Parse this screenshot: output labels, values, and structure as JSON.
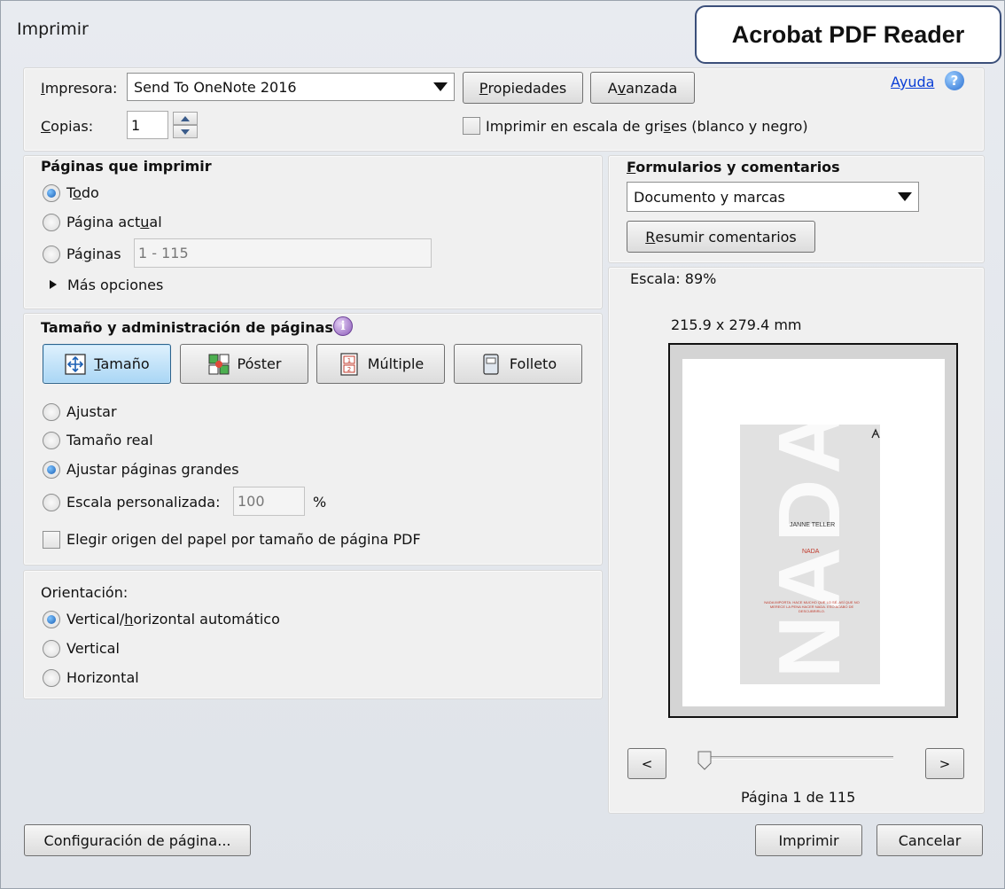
{
  "window": {
    "title": "Imprimir",
    "badge": "Acrobat PDF Reader"
  },
  "printer": {
    "label_pre": "",
    "label_u": "I",
    "label_post": "mpresora:",
    "value": "Send To OneNote 2016",
    "properties_pre": "",
    "properties_u": "P",
    "properties_post": "ropiedades",
    "advanced_pre": "A",
    "advanced_u": "v",
    "advanced_post": "anzada",
    "help_link": "Ayuda",
    "help_icon": "?"
  },
  "copies": {
    "label_pre": "",
    "label_u": "C",
    "label_post": "opias:",
    "value": "1",
    "grayscale_pre": "Imprimir en escala de gri",
    "grayscale_u": "s",
    "grayscale_post": "es (blanco y negro)",
    "grayscale_checked": false
  },
  "pages": {
    "heading": "Páginas que imprimir",
    "all_pre": "T",
    "all_u": "o",
    "all_post": "do",
    "current_pre": "Página act",
    "current_u": "u",
    "current_post": "al",
    "range_pre": "Pá",
    "range_u": "g",
    "range_post": "inas",
    "range_value": "1 - 115",
    "more": "Más opciones",
    "selected": "all"
  },
  "sizing": {
    "heading": "Tamaño y administración de páginas",
    "info_icon": "i",
    "buttons": [
      {
        "pre": "",
        "u": "T",
        "post": "amaño",
        "icon": "size-icon",
        "active": true
      },
      {
        "pre": "Póster",
        "u": "",
        "post": "",
        "icon": "poster-icon",
        "active": false
      },
      {
        "pre": "Múltiple",
        "u": "",
        "post": "",
        "icon": "multiple-icon",
        "active": false
      },
      {
        "pre": "Folleto",
        "u": "",
        "post": "",
        "icon": "booklet-icon",
        "active": false
      }
    ],
    "fit": "Ajustar",
    "actual": "Tamaño real",
    "shrink": "Ajustar páginas grandes",
    "custom": "Escala personalizada:",
    "custom_value": "100",
    "percent": "%",
    "paper_source": "Elegir origen del papel por tamaño de página PDF",
    "selected": "shrink"
  },
  "orientation": {
    "heading": "Orientación:",
    "auto_pre": "Vertical/",
    "auto_u": "h",
    "auto_post": "orizontal automático",
    "portrait": "Vertical",
    "landscape": "Horizontal",
    "selected": "auto"
  },
  "forms": {
    "heading_pre": "",
    "heading_u": "F",
    "heading_post": "ormularios y comentarios",
    "value": "Documento y marcas",
    "summarize_pre": "",
    "summarize_u": "R",
    "summarize_post": "esumir comentarios"
  },
  "preview": {
    "scale": "Escala:  89%",
    "dimensions": "215.9 x 279.4 mm",
    "book": {
      "title": "NADA",
      "author": "JANNE TELLER",
      "subtitle": "NADA",
      "tagline": "NADA IMPORTA. HACE MUCHO QUE LO SÉ. ASÍ QUE NO MERECE LA PENA HACER NADA. ESO ACABO DE DESCUBRIRLO."
    },
    "prev": "<",
    "next": ">",
    "page_label": "Página 1 de 115",
    "slider_position": 0
  },
  "footer": {
    "setup": "Configuración de página...",
    "print": "Imprimir",
    "cancel": "Cancelar"
  },
  "colors": {
    "accent": "#1a5fb4",
    "link": "#0b3fd6",
    "active_button": "#a9d6f5"
  }
}
